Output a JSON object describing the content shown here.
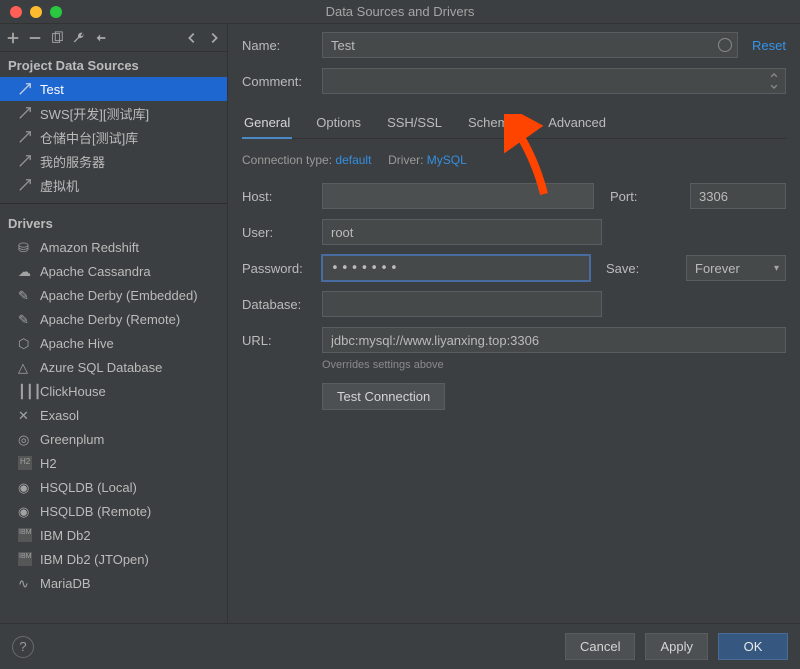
{
  "window": {
    "title": "Data Sources and Drivers"
  },
  "header": {
    "reset": "Reset"
  },
  "left": {
    "sections": {
      "project": "Project Data Sources",
      "drivers": "Drivers"
    },
    "dataSources": [
      {
        "label": "Test",
        "selected": true
      },
      {
        "label": "SWS[开发][测试库]"
      },
      {
        "label": "仓储中台[测试]库"
      },
      {
        "label": "我的服务器"
      },
      {
        "label": "虚拟机"
      }
    ],
    "drivers": [
      {
        "label": "Amazon Redshift"
      },
      {
        "label": "Apache Cassandra"
      },
      {
        "label": "Apache Derby (Embedded)"
      },
      {
        "label": "Apache Derby (Remote)"
      },
      {
        "label": "Apache Hive"
      },
      {
        "label": "Azure SQL Database"
      },
      {
        "label": "ClickHouse"
      },
      {
        "label": "Exasol"
      },
      {
        "label": "Greenplum"
      },
      {
        "label": "H2"
      },
      {
        "label": "HSQLDB (Local)"
      },
      {
        "label": "HSQLDB (Remote)"
      },
      {
        "label": "IBM Db2"
      },
      {
        "label": "IBM Db2 (JTOpen)"
      },
      {
        "label": "MariaDB"
      }
    ]
  },
  "form": {
    "nameLabel": "Name:",
    "nameValue": "Test",
    "commentLabel": "Comment:",
    "commentValue": "",
    "tabs": {
      "general": "General",
      "options": "Options",
      "ssh": "SSH/SSL",
      "schemas": "Schemas",
      "advanced": "Advanced"
    },
    "connTypeLabel": "Connection type:",
    "connTypeValue": "default",
    "driverLabel": "Driver:",
    "driverValue": "MySQL",
    "hostLabel": "Host:",
    "hostValue": " ",
    "portLabel": "Port:",
    "portValue": "3306",
    "userLabel": "User:",
    "userValue": "root",
    "passwordLabel": "Password:",
    "passwordValue": "•••••••",
    "saveLabel": "Save:",
    "saveValue": "Forever",
    "databaseLabel": "Database:",
    "databaseValue": "",
    "urlLabel": "URL:",
    "urlValue": "jdbc:mysql://www.liyanxing.top:3306",
    "urlHint": "Overrides settings above",
    "testConnection": "Test Connection"
  },
  "footer": {
    "help": "?",
    "cancel": "Cancel",
    "apply": "Apply",
    "ok": "OK"
  }
}
